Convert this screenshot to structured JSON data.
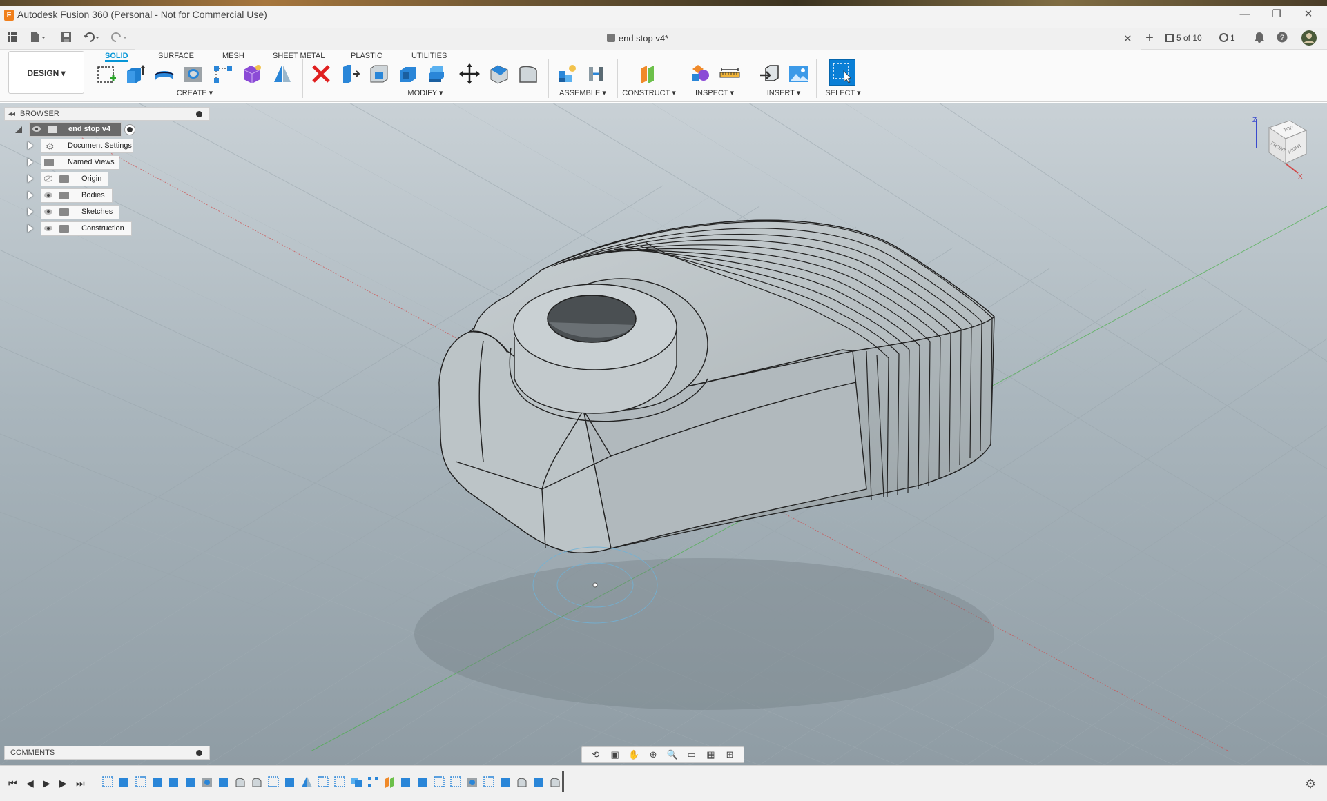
{
  "window": {
    "title": "Autodesk Fusion 360 (Personal - Not for Commercial Use)",
    "app_icon": "F",
    "minimize": "—",
    "restore": "❐",
    "close": "✕"
  },
  "quick_access": {
    "doc_title": "end stop v4*",
    "new_tab": "+",
    "jobs_status": "5 of 10",
    "clock_count": "1"
  },
  "ribbon": {
    "workspace": "DESIGN ▾",
    "tabs": [
      "SOLID",
      "SURFACE",
      "MESH",
      "SHEET METAL",
      "PLASTIC",
      "UTILITIES"
    ],
    "active_tab": "SOLID",
    "groups": {
      "create": "CREATE ▾",
      "modify": "MODIFY ▾",
      "assemble": "ASSEMBLE ▾",
      "construct": "CONSTRUCT ▾",
      "inspect": "INSPECT ▾",
      "insert": "INSERT ▾",
      "select": "SELECT ▾"
    }
  },
  "browser": {
    "title": "BROWSER",
    "collapse_glyph": "◂◂",
    "root": "end stop v4",
    "items": [
      {
        "label": "Document Settings",
        "icon": "gear-icon"
      },
      {
        "label": "Named Views",
        "icon": "folder-icon"
      },
      {
        "label": "Origin",
        "icon": "folder-icon"
      },
      {
        "label": "Bodies",
        "icon": "folder-icon"
      },
      {
        "label": "Sketches",
        "icon": "folder-icon"
      },
      {
        "label": "Construction",
        "icon": "folder-icon"
      }
    ]
  },
  "viewcube": {
    "top": "TOP",
    "front": "FRONT",
    "right": "RIGHT",
    "z_axis": "Z",
    "x_axis": "X"
  },
  "comments": {
    "title": "COMMENTS"
  },
  "timeline": {
    "first": "⏮",
    "prev": "◀",
    "play": "▶",
    "next": "▶",
    "last": "⏭",
    "settings": "⚙"
  },
  "colors": {
    "accent": "#0696d7",
    "model_fill": "#b8bfc2",
    "viewport_top": "#c9d1d6",
    "viewport_bottom": "#8f9ca4",
    "delete_red": "#e02020"
  }
}
